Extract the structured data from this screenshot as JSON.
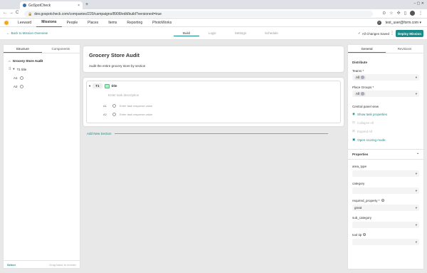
{
  "browser": {
    "tab_title": "GoSpotCheck",
    "tab_close": "×",
    "new_tab": "+",
    "window_controls": "–  ▢  ✕",
    "back": "←",
    "forward": "→",
    "reload": "C",
    "url": "dev.gospotcheck.com/companies/220/campaigns/8908/edit/build?versioned=true"
  },
  "app_nav": {
    "items": [
      "Leeward",
      "Missions",
      "People",
      "Places",
      "Items",
      "Reporting",
      "PhotoWorks"
    ],
    "user": "test_user@form.com",
    "help": "?"
  },
  "subheader": {
    "back_label": "Back to Mission Overview",
    "steps": [
      "Build",
      "Logic",
      "Settings",
      "Schedule"
    ],
    "saved_label": "All Changes Saved",
    "deploy_label": "Deploy Mission"
  },
  "left_panel": {
    "tabs": [
      "Structure",
      "Components"
    ],
    "mission_title": "Grocery Store Audit",
    "task_label": "T1  title",
    "answers": [
      "A1",
      "A2"
    ],
    "footer_select": "Select",
    "footer_hint": "Drag tasks to reorder"
  },
  "canvas": {
    "title": "Grocery Store Audit",
    "description": "Audit the entire grocery store by section",
    "task_number": "T1",
    "task_name": "title",
    "task_description_placeholder": "Enter task description",
    "answers": [
      {
        "label": "A1",
        "placeholder": "Enter task response value"
      },
      {
        "label": "A2",
        "placeholder": "Enter task response value"
      }
    ],
    "add_section": "Add New Section"
  },
  "right_panel": {
    "tabs": [
      "General",
      "Revisions"
    ],
    "distribute": "Distribute",
    "teams_label": "Teams *",
    "teams_value": "All",
    "place_groups_label": "Place Groups *",
    "place_groups_value": "All",
    "central_panel_view": "Central panel view",
    "show_task_properties": "Show task properties",
    "collapse_all": "Collapse All",
    "expand_all": "Expand All",
    "open_scoring_mode": "Open scoring mode",
    "properties": "Properties",
    "fields": [
      {
        "label": "area_type",
        "value": ""
      },
      {
        "label": "category",
        "value": ""
      },
      {
        "label": "required_property *",
        "value": "great"
      },
      {
        "label": "sub_category",
        "value": ""
      },
      {
        "label": "tool tip",
        "value": ""
      }
    ]
  },
  "colors": {
    "accent": "#1b8a8a",
    "logo": "#f5a623"
  }
}
